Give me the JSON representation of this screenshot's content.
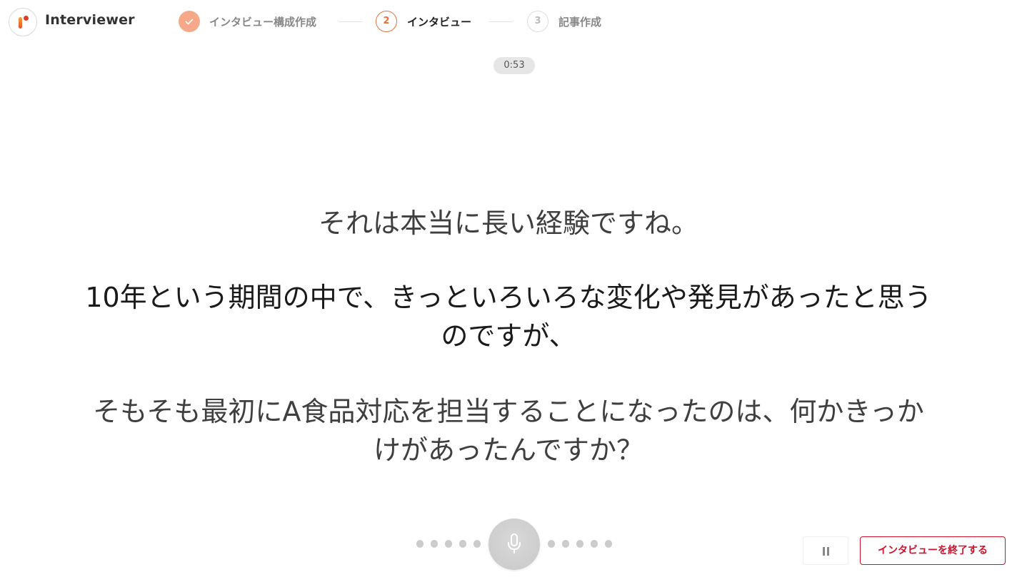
{
  "app": {
    "name": "Interviewer"
  },
  "steps": [
    {
      "number": "",
      "label": "インタビュー構成作成",
      "state": "done"
    },
    {
      "number": "2",
      "label": "インタビュー",
      "state": "active"
    },
    {
      "number": "3",
      "label": "記事作成",
      "state": "todo"
    }
  ],
  "timer": "0:53",
  "question": {
    "paragraphs": [
      "それは本当に長い経験ですね。",
      "10年という期間の中で、きっといろいろな変化や発見があったと思うのですが、",
      "そもそも最初にA食品対応を担当することになったのは、何かきっかけがあったんですか？"
    ]
  },
  "controls": {
    "mic_icon": "microphone-icon",
    "pause_icon": "pause-icon",
    "end_button_label": "インタビューを終了する"
  },
  "colors": {
    "accent": "#e8703a",
    "done": "#f5a98a",
    "danger": "#d0112b"
  }
}
